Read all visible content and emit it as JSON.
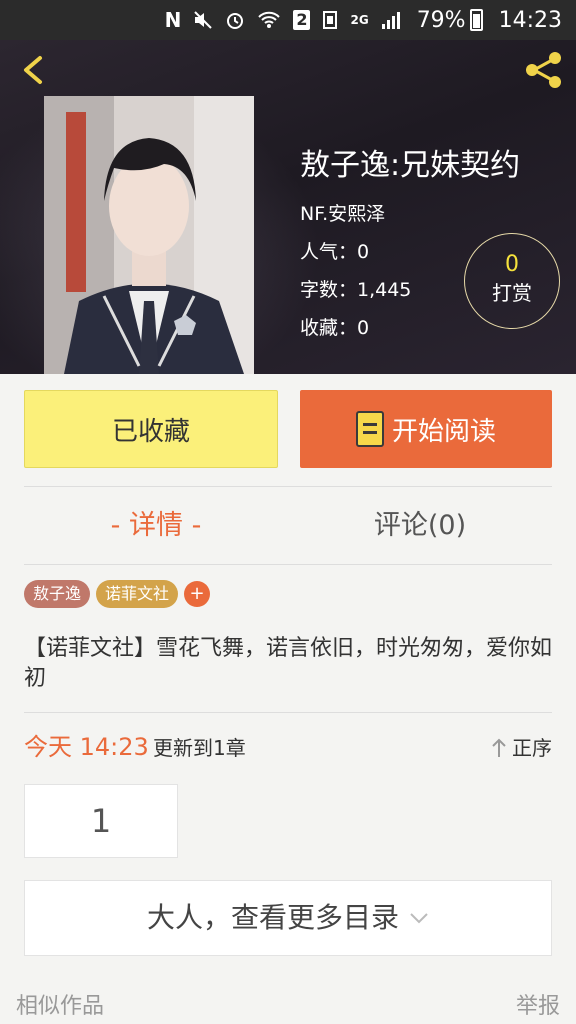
{
  "status_bar": {
    "battery": "79%",
    "time": "14:23",
    "sim": "2",
    "network": "2G"
  },
  "header": {
    "title": "敖子逸:兄妹契约",
    "author": "NF.安熙泽",
    "popularity": "人气：0",
    "word_count": "字数：1,445",
    "favorites": "收藏：0",
    "tip_count": "0",
    "tip_label": "打赏"
  },
  "actions": {
    "collect_label": "已收藏",
    "read_label": "开始阅读"
  },
  "tabs": {
    "detail": "- 详情 -",
    "comment": "评论(0)"
  },
  "tags": [
    "敖子逸",
    "诺菲文社"
  ],
  "tag_add": "+",
  "description": "【诺菲文社】雪花飞舞，诺言依旧，时光匆匆，爱你如初",
  "update": {
    "time": "今天 14:23",
    "text": "更新到1章",
    "order": "正序"
  },
  "chapter_number": "1",
  "more_catalog": "大人，查看更多目录",
  "footer": {
    "similar": "相似作品",
    "report": "举报"
  },
  "colors": {
    "accent": "#ea6a3b",
    "collect_bg": "#fbf07a",
    "header_bg": "#1e1a22",
    "icon_yellow": "#f0d34a"
  }
}
